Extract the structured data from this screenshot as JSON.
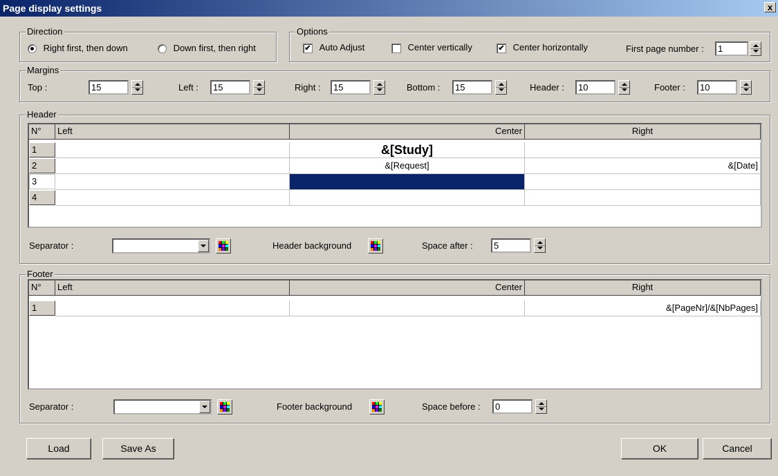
{
  "window": {
    "title": "Page display settings",
    "close_label": "x"
  },
  "direction": {
    "label": "Direction",
    "opt1": "Right first, then down",
    "opt2": "Down first, then right",
    "selected": "Right first, then down"
  },
  "options": {
    "label": "Options",
    "auto_adjust": {
      "label": "Auto Adjust",
      "checked": true
    },
    "center_vertically": {
      "label": "Center vertically",
      "checked": false
    },
    "center_horizontally": {
      "label": "Center horizontally",
      "checked": true
    },
    "first_page_label": "First page number :",
    "first_page_value": "1"
  },
  "margins": {
    "label": "Margins",
    "top_label": "Top :",
    "top_value": "15",
    "left_label": "Left :",
    "left_value": "15",
    "right_label": "Right :",
    "right_value": "15",
    "bottom_label": "Bottom :",
    "bottom_value": "15",
    "header_label": "Header :",
    "header_value": "10",
    "footer_label": "Footer :",
    "footer_value": "10"
  },
  "header": {
    "label": "Header",
    "columns": [
      "N°",
      "Left",
      "Center",
      "Right"
    ],
    "rows": [
      {
        "n": "1",
        "left": "",
        "center": "&[Study]",
        "right": ""
      },
      {
        "n": "2",
        "left": "",
        "center": "&[Request]",
        "right": "&[Date]"
      },
      {
        "n": "3",
        "left": "",
        "center": "",
        "right": ""
      },
      {
        "n": "4",
        "left": "",
        "center": "",
        "right": ""
      }
    ],
    "selected_color": "#0a246a",
    "separator_label": "Separator :",
    "background_label": "Header background",
    "space_label": "Space after :",
    "space_value": "5"
  },
  "footer": {
    "label": "Footer",
    "columns": [
      "N°",
      "Left",
      "Center",
      "Right"
    ],
    "rows": [
      {
        "n": "1",
        "left": "",
        "center": "",
        "right": "&[PageNr]/&[NbPages]"
      }
    ],
    "separator_label": "Separator :",
    "background_label": "Footer background",
    "space_label": "Space before :",
    "space_value": "0"
  },
  "buttons": {
    "load": "Load",
    "save_as": "Save As",
    "ok": "OK",
    "cancel": "Cancel"
  },
  "icons": {
    "palette": "color-palette-icon",
    "spin": "spinner-arrows-icon",
    "dropdown": "chevron-down-icon"
  }
}
